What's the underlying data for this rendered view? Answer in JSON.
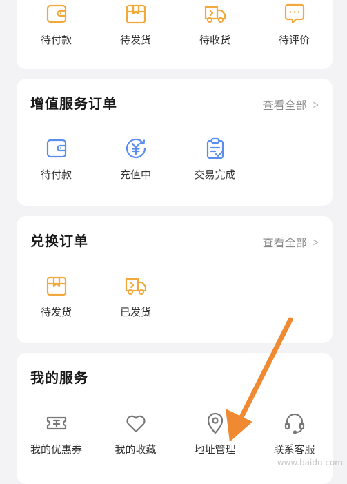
{
  "top_orders": {
    "items": [
      {
        "label": "待付款",
        "icon": "wallet-icon"
      },
      {
        "label": "待发货",
        "icon": "box-icon"
      },
      {
        "label": "待收货",
        "icon": "truck-icon"
      },
      {
        "label": "待评价",
        "icon": "comment-icon"
      }
    ]
  },
  "vas_orders": {
    "title": "增值服务订单",
    "view_all": "查看全部",
    "items": [
      {
        "label": "待付款",
        "icon": "wallet-icon"
      },
      {
        "label": "充值中",
        "icon": "yuan-recharge-icon"
      },
      {
        "label": "交易完成",
        "icon": "clipboard-check-icon"
      }
    ]
  },
  "exchange_orders": {
    "title": "兑换订单",
    "view_all": "查看全部",
    "items": [
      {
        "label": "待发货",
        "icon": "box-icon"
      },
      {
        "label": "已发货",
        "icon": "truck-icon"
      }
    ]
  },
  "my_services": {
    "title": "我的服务",
    "items": [
      {
        "label": "我的优惠券",
        "icon": "coupon-icon"
      },
      {
        "label": "我的收藏",
        "icon": "heart-icon"
      },
      {
        "label": "地址管理",
        "icon": "location-pin-icon"
      },
      {
        "label": "联系客服",
        "icon": "headset-icon"
      }
    ]
  },
  "watermark": "www.baidu.com",
  "colors": {
    "accent_orange": "#F2A93B",
    "accent_blue": "#5B8DEF",
    "service_gray": "#777777",
    "annotation_arrow": "#F08A32"
  }
}
